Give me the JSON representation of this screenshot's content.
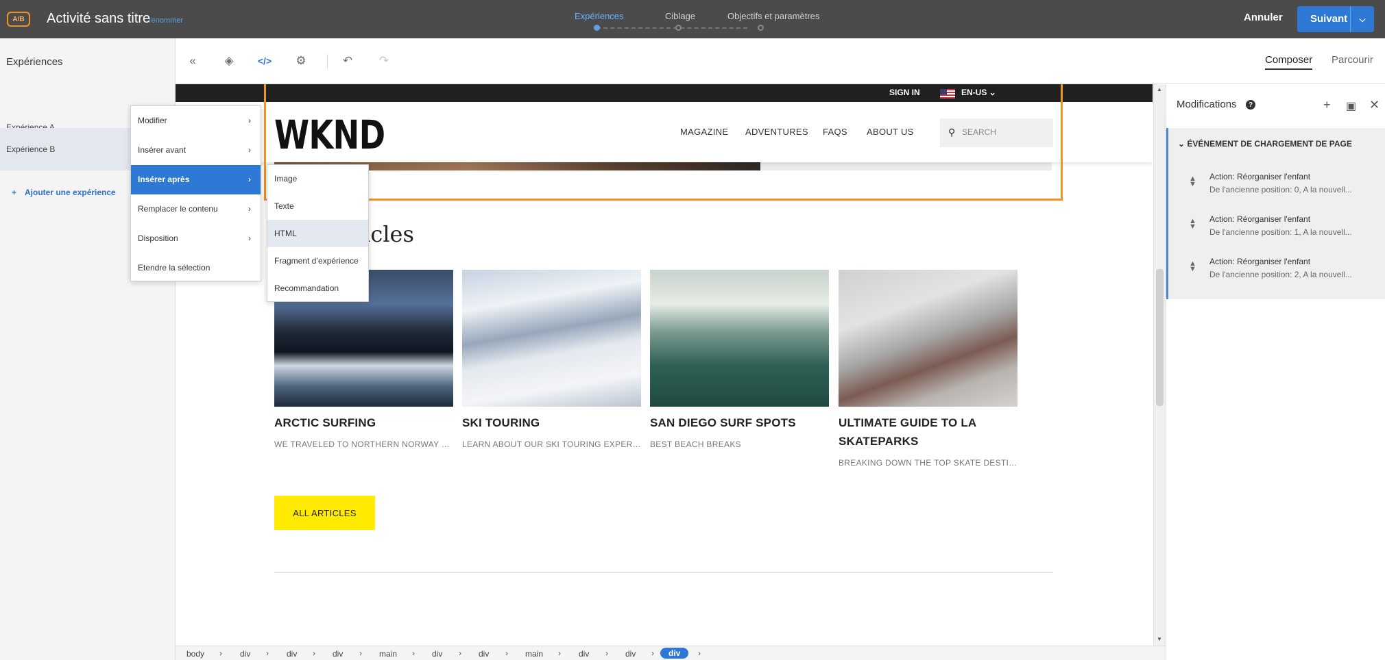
{
  "topbar": {
    "badge": "A/B",
    "title": "Activité sans titre",
    "rename": "renommer",
    "steps": [
      "Expériences",
      "Ciblage",
      "Objectifs et paramètres"
    ],
    "cancel": "Annuler",
    "next": "Suivant",
    "accent": "#2d79d5"
  },
  "sidebar": {
    "title": "Expériences",
    "items": [
      "Expérience A",
      "Expérience B"
    ],
    "add": "Ajouter une expérience"
  },
  "toolbar": {
    "icons": [
      "collapse-icon",
      "layers-icon",
      "code-icon",
      "settings-icon",
      "undo-icon",
      "redo-icon"
    ],
    "tab_compose": "Composer",
    "tab_browse": "Parcourir"
  },
  "site": {
    "signin": "SIGN IN",
    "locale": "EN-US",
    "logo": "WKND",
    "nav": [
      "MAGAZINE",
      "ADVENTURES",
      "FAQS",
      "ABOUT US"
    ],
    "search_placeholder": "SEARCH",
    "section_title": "rticles",
    "cards": [
      {
        "title": "ARCTIC SURFING",
        "desc": "WE TRAVELED TO NORTHERN NORWAY TO…"
      },
      {
        "title": "SKI TOURING",
        "desc": "LEARN ABOUT OUR SKI TOURING EXPERIE…"
      },
      {
        "title": "SAN DIEGO SURF SPOTS",
        "desc": "BEST BEACH BREAKS"
      },
      {
        "title": "ULTIMATE GUIDE TO LA SKATEPARKS",
        "desc": "BREAKING DOWN THE TOP SKATE DESTIN…"
      }
    ],
    "all_articles": "ALL ARTICLES"
  },
  "context_menu": {
    "items": [
      "Modifier",
      "Insérer avant",
      "Insérer après",
      "Remplacer le contenu",
      "Disposition",
      "Etendre la sélection"
    ],
    "submenu": [
      "Image",
      "Texte",
      "HTML",
      "Fragment d’expérience",
      "Recommandation"
    ]
  },
  "modifications": {
    "title": "Modifications",
    "help": "?",
    "group": "ÉVÉNEMENT DE CHARGEMENT DE PAGE",
    "actions": [
      {
        "title": "Action: Réorganiser l'enfant",
        "detail": "De l'ancienne position: 0, A la nouvell..."
      },
      {
        "title": "Action: Réorganiser l'enfant",
        "detail": "De l'ancienne position: 1, A la nouvell..."
      },
      {
        "title": "Action: Réorganiser l'enfant",
        "detail": "De l'ancienne position: 2, A la nouvell..."
      }
    ]
  },
  "breadcrumb": [
    "body",
    "div",
    "div",
    "div",
    "main",
    "div",
    "div",
    "main",
    "div",
    "div",
    "div"
  ]
}
